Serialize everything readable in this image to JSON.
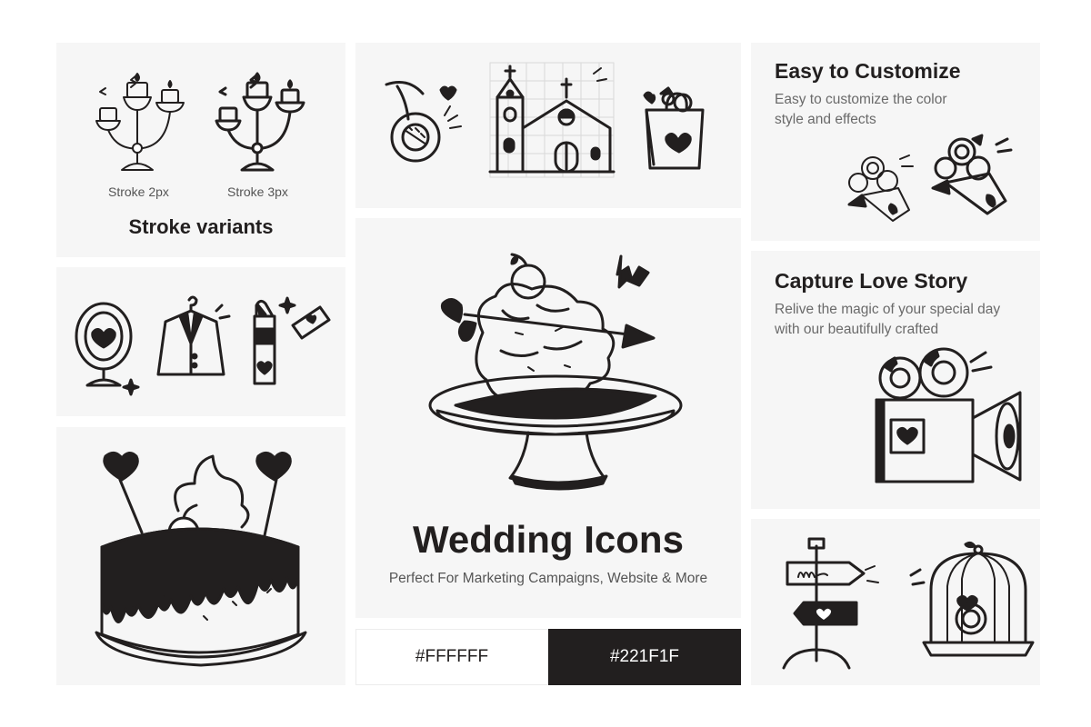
{
  "stroke_card": {
    "caption_2px": "Stroke 2px",
    "caption_3px": "Stroke 3px",
    "title": "Stroke variants"
  },
  "customize_card": {
    "title": "Easy to Customize",
    "description": "Easy to customize the color style and effects"
  },
  "love_story_card": {
    "title": "Capture Love Story",
    "description": "Relive the magic of your special day with our beautifully crafted"
  },
  "hero_card": {
    "title": "Wedding Icons",
    "subtitle": "Perfect For Marketing Campaigns, Website & More"
  },
  "swatches": {
    "light": {
      "label": "#FFFFFF",
      "color": "#FFFFFF"
    },
    "dark": {
      "label": "#221F1F",
      "color": "#221F1F"
    }
  },
  "icons": [
    "candelabra-icon",
    "french-horn-icon",
    "church-icon",
    "gift-bag-icon",
    "flower-bouquet-icon",
    "mirror-icon",
    "tuxedo-icon",
    "lipstick-icon",
    "cupid-cake-icon",
    "wedding-cake-icon",
    "movie-camera-icon",
    "signpost-icon",
    "birdcage-ring-icon"
  ]
}
